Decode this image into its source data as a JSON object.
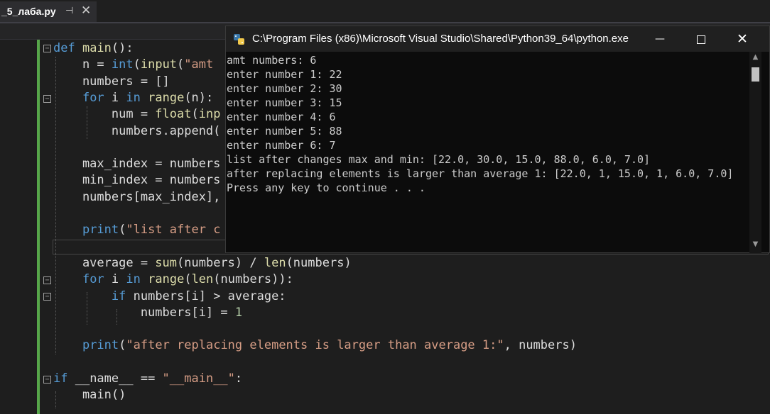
{
  "tab": {
    "title": "_5_лаба.py",
    "pin_icon": "pin-icon",
    "close_icon": "close-icon"
  },
  "editor": {
    "lines": [
      [
        {
          "t": "def ",
          "c": "kw"
        },
        {
          "t": "main",
          "c": "fn"
        },
        {
          "t": "():",
          "c": ""
        }
      ],
      [
        {
          "t": "    n = ",
          "c": ""
        },
        {
          "t": "int",
          "c": "kw"
        },
        {
          "t": "(",
          "c": ""
        },
        {
          "t": "input",
          "c": "fn"
        },
        {
          "t": "(",
          "c": ""
        },
        {
          "t": "\"amt",
          "c": "str"
        }
      ],
      [
        {
          "t": "    numbers = []",
          "c": ""
        }
      ],
      [
        {
          "t": "    ",
          "c": ""
        },
        {
          "t": "for",
          "c": "kw"
        },
        {
          "t": " i ",
          "c": ""
        },
        {
          "t": "in",
          "c": "kw"
        },
        {
          "t": " ",
          "c": ""
        },
        {
          "t": "range",
          "c": "fn"
        },
        {
          "t": "(n):",
          "c": ""
        }
      ],
      [
        {
          "t": "        num = ",
          "c": ""
        },
        {
          "t": "float",
          "c": "fn"
        },
        {
          "t": "(",
          "c": ""
        },
        {
          "t": "inp",
          "c": "fn"
        }
      ],
      [
        {
          "t": "        numbers.append(",
          "c": ""
        }
      ],
      [],
      [
        {
          "t": "    max_index = numbers",
          "c": ""
        }
      ],
      [
        {
          "t": "    min_index = numbers",
          "c": ""
        }
      ],
      [
        {
          "t": "    numbers[max_index],",
          "c": ""
        }
      ],
      [],
      [
        {
          "t": "    ",
          "c": ""
        },
        {
          "t": "print",
          "c": "kw"
        },
        {
          "t": "(",
          "c": ""
        },
        {
          "t": "\"list after c",
          "c": "str"
        }
      ],
      [],
      [
        {
          "t": "    average = ",
          "c": ""
        },
        {
          "t": "sum",
          "c": "fn"
        },
        {
          "t": "(numbers) / ",
          "c": ""
        },
        {
          "t": "len",
          "c": "fn"
        },
        {
          "t": "(numbers)",
          "c": ""
        }
      ],
      [
        {
          "t": "    ",
          "c": ""
        },
        {
          "t": "for",
          "c": "kw"
        },
        {
          "t": " i ",
          "c": ""
        },
        {
          "t": "in",
          "c": "kw"
        },
        {
          "t": " ",
          "c": ""
        },
        {
          "t": "range",
          "c": "fn"
        },
        {
          "t": "(",
          "c": ""
        },
        {
          "t": "len",
          "c": "fn"
        },
        {
          "t": "(numbers)):",
          "c": ""
        }
      ],
      [
        {
          "t": "        ",
          "c": ""
        },
        {
          "t": "if",
          "c": "kw"
        },
        {
          "t": " numbers[i] > average:",
          "c": ""
        }
      ],
      [
        {
          "t": "            numbers[i] = ",
          "c": ""
        },
        {
          "t": "1",
          "c": "num"
        }
      ],
      [],
      [
        {
          "t": "    ",
          "c": ""
        },
        {
          "t": "print",
          "c": "kw"
        },
        {
          "t": "(",
          "c": ""
        },
        {
          "t": "\"after replacing elements is larger than average 1:\"",
          "c": "str"
        },
        {
          "t": ", numbers)",
          "c": ""
        }
      ],
      [],
      [
        {
          "t": "if",
          "c": "kw"
        },
        {
          "t": " __name__ == ",
          "c": ""
        },
        {
          "t": "\"__main__\"",
          "c": "str"
        },
        {
          "t": ":",
          "c": ""
        }
      ],
      [
        {
          "t": "    main()",
          "c": ""
        }
      ]
    ]
  },
  "console": {
    "title": "C:\\Program Files (x86)\\Microsoft Visual Studio\\Shared\\Python39_64\\python.exe",
    "minimize_label": "—",
    "close_label": "✕",
    "output": [
      "amt numbers: 6",
      "enter number 1: 22",
      "enter number 2: 30",
      "enter number 3: 15",
      "enter number 4: 6",
      "enter number 5: 88",
      "enter number 6: 7",
      "list after changes max and min: [22.0, 30.0, 15.0, 88.0, 6.0, 7.0]",
      "after replacing elements is larger than average 1: [22.0, 1, 15.0, 1, 6.0, 7.0]",
      "Press any key to continue . . ."
    ]
  },
  "colors": {
    "keyword": "#569cd6",
    "function": "#dcdcaa",
    "string": "#d69d85",
    "number": "#b5cea8",
    "change_bar": "#57a64a"
  }
}
